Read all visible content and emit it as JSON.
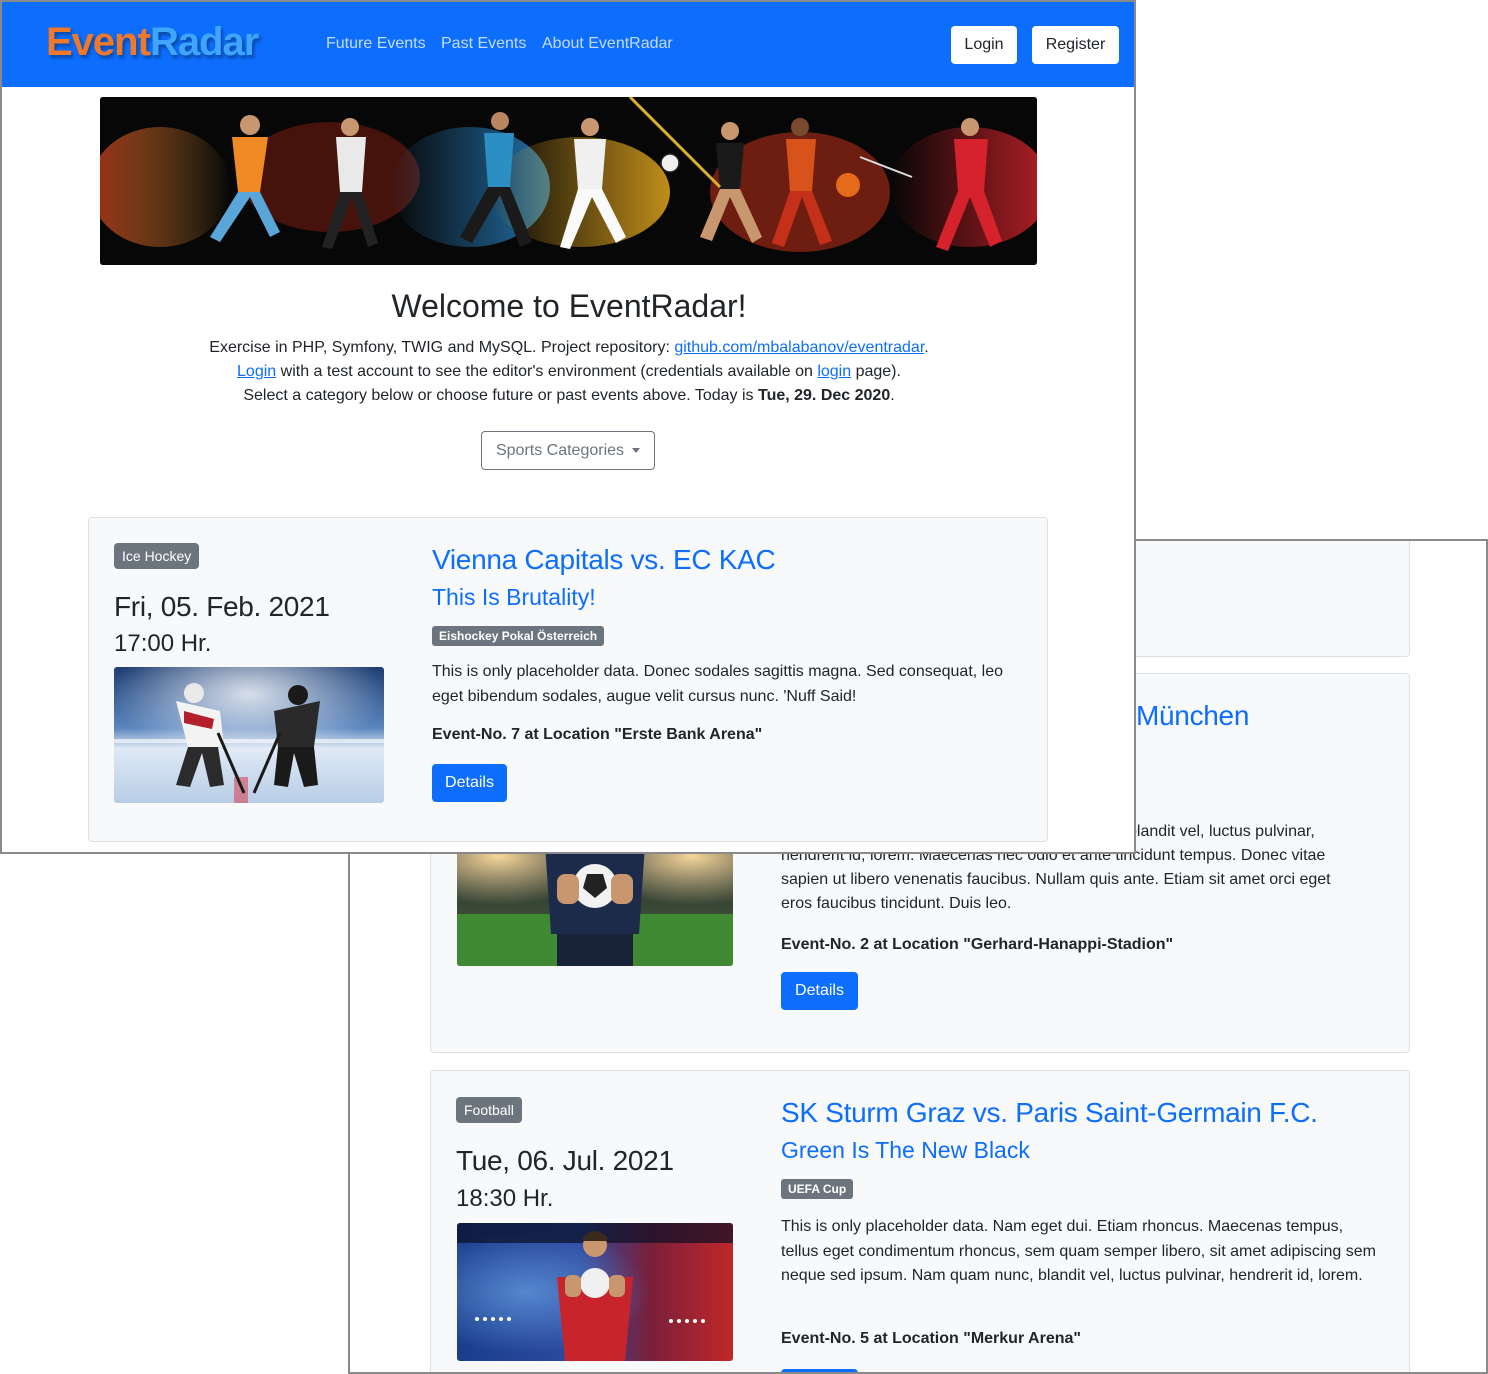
{
  "navbar": {
    "brand_part1": "Event",
    "brand_part2": "Radar",
    "links": [
      "Future Events",
      "Past Events",
      "About EventRadar"
    ],
    "login_label": "Login",
    "register_label": "Register"
  },
  "intro": {
    "title": "Welcome to EventRadar!",
    "line1_text": "Exercise in PHP, Symfony, TWIG and MySQL. Project repository: ",
    "line1_link": "github.com/mbalabanov/eventradar",
    "line1_end": ".",
    "line2_link1": "Login",
    "line2_text": " with a test account to see the editor's environment (credentials available on ",
    "line2_link2": "login",
    "line2_end": " page).",
    "line3_text": "Select a category below or choose future or past events above. Today is ",
    "line3_date": "Tue, 29. Dec 2020",
    "line3_end": ".",
    "dropdown_label": "Sports Categories"
  },
  "events": [
    {
      "category": "Ice Hockey",
      "date": "Fri, 05. Feb. 2021",
      "time": "17:00 Hr.",
      "title": "Vienna Capitals vs. EC KAC",
      "subtitle": "This Is Brutality!",
      "league": "Eishockey Pokal Österreich",
      "description": "This is only placeholder data. Donec sodales sagittis magna. Sed consequat, leo eget bibendum sodales, augue velit cursus nunc. 'Nuff Said!",
      "location": "Event-No. 7 at Location \"Erste Bank Arena\"",
      "details_label": "Details"
    },
    {
      "title_fragment": "München",
      "description_line1": "blandit vel, luctus pulvinar,",
      "description_line2": "hendrerit id, lorem. Maecenas nec odio et ante tincidunt tempus. Donec vitae",
      "description_line3": "sapien ut libero venenatis faucibus. Nullam quis ante. Etiam sit amet orci eget",
      "description_line4": "eros faucibus tincidunt. Duis leo.",
      "location": "Event-No. 2 at Location \"Gerhard-Hanappi-Stadion\"",
      "details_label": "Details"
    },
    {
      "category": "Football",
      "date": "Tue, 06. Jul. 2021",
      "time": "18:30 Hr.",
      "title": "SK Sturm Graz vs. Paris Saint-Germain F.C.",
      "subtitle": "Green Is The New Black",
      "league": "UEFA Cup",
      "description": "This is only placeholder data. Nam eget dui. Etiam rhoncus. Maecenas tempus, tellus eget condimentum rhoncus, sem quam semper libero, sit amet adipiscing sem neque sed ipsum. Nam quam nunc, blandit vel, luctus pulvinar, hendrerit id, lorem.",
      "location": "Event-No. 5 at Location \"Merkur Arena\""
    }
  ],
  "icons": {
    "dropdown_caret": "caret-down-icon"
  },
  "colors": {
    "primary": "#0d6efd",
    "badge": "#6c757d",
    "card_bg": "#f8f9fa"
  }
}
